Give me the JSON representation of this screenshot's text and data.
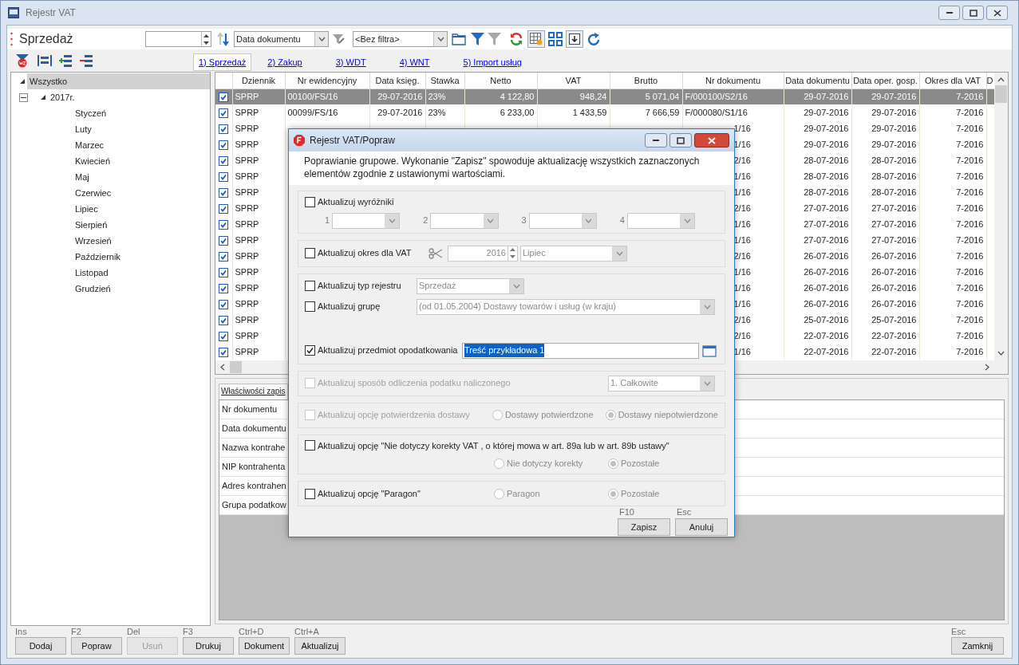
{
  "window": {
    "title": "Rejestr VAT"
  },
  "header": {
    "title": "Sprzedaż",
    "sort_field": "Data dokumentu",
    "filter": "<Bez filtra>"
  },
  "register_tabs": [
    {
      "label": "1) Sprzedaż",
      "selected": true
    },
    {
      "label": "2) Zakup",
      "selected": false
    },
    {
      "label": "3) WDT",
      "selected": false
    },
    {
      "label": "4) WNT",
      "selected": false
    },
    {
      "label": "5) Import usług",
      "selected": false
    }
  ],
  "tree": [
    {
      "label": "Wszystko",
      "selected": true,
      "expanded": true,
      "children": [
        {
          "label": "2017r.",
          "selected": false,
          "expanded": true,
          "children": [
            {
              "label": "Styczeń",
              "selected": false
            },
            {
              "label": "Luty",
              "selected": false
            },
            {
              "label": "Marzec",
              "selected": false
            },
            {
              "label": "Kwiecień",
              "selected": false
            },
            {
              "label": "Maj",
              "selected": false
            },
            {
              "label": "Czerwiec",
              "selected": false
            },
            {
              "label": "Lipiec",
              "selected": false
            },
            {
              "label": "Sierpień",
              "selected": false
            },
            {
              "label": "Wrzesień",
              "selected": false
            },
            {
              "label": "Październik",
              "selected": false
            },
            {
              "label": "Listopad",
              "selected": false
            },
            {
              "label": "Grudzień",
              "selected": false
            }
          ]
        }
      ]
    }
  ],
  "table": {
    "columns": [
      "Dziennik",
      "Nr ewidencyjny",
      "Data księg.",
      "Stawka",
      "Netto",
      "VAT",
      "Brutto",
      "Nr dokumentu",
      "Data dokumentu",
      "Data oper. gosp.",
      "Okres dla VAT",
      "D"
    ],
    "rows": [
      {
        "checked": true,
        "selected": true,
        "dziennik": "SPRP",
        "nr_ewidencyjny": "00100/FS/16",
        "data_ksieg": "29-07-2016",
        "stawka": "23%",
        "netto": "4 122,80",
        "vat": "948,24",
        "brutto": "5 071,04",
        "nr_dokumentu": "F/000100/S2/16",
        "data_dokumentu": "29-07-2016",
        "data_oper": "29-07-2016",
        "okres": "7-2016"
      },
      {
        "checked": true,
        "selected": false,
        "dziennik": "SPRP",
        "nr_ewidencyjny": "00099/FS/16",
        "data_ksieg": "29-07-2016",
        "stawka": "23%",
        "netto": "6 233,00",
        "vat": "1 433,59",
        "brutto": "7 666,59",
        "nr_dokumentu": "F/000080/S1/16",
        "data_dokumentu": "29-07-2016",
        "data_oper": "29-07-2016",
        "okres": "7-2016"
      },
      {
        "checked": true,
        "selected": false,
        "covered_by_dialog": true,
        "dziennik": "SPRP",
        "nr_dokumentu": "1/16",
        "data_dokumentu": "29-07-2016",
        "data_oper": "29-07-2016",
        "okres": "7-2016"
      },
      {
        "checked": true,
        "selected": false,
        "covered_by_dialog": true,
        "dziennik": "SPRP",
        "nr_dokumentu": "1/16",
        "data_dokumentu": "29-07-2016",
        "data_oper": "29-07-2016",
        "okres": "7-2016"
      },
      {
        "checked": true,
        "selected": false,
        "covered_by_dialog": true,
        "dziennik": "SPRP",
        "nr_dokumentu": "2/16",
        "data_dokumentu": "28-07-2016",
        "data_oper": "28-07-2016",
        "okres": "7-2016"
      },
      {
        "checked": true,
        "selected": false,
        "covered_by_dialog": true,
        "dziennik": "SPRP",
        "nr_dokumentu": "1/16",
        "data_dokumentu": "28-07-2016",
        "data_oper": "28-07-2016",
        "okres": "7-2016"
      },
      {
        "checked": true,
        "selected": false,
        "covered_by_dialog": true,
        "dziennik": "SPRP",
        "nr_dokumentu": "1/16",
        "data_dokumentu": "28-07-2016",
        "data_oper": "28-07-2016",
        "okres": "7-2016"
      },
      {
        "checked": true,
        "selected": false,
        "covered_by_dialog": true,
        "dziennik": "SPRP",
        "nr_dokumentu": "2/16",
        "data_dokumentu": "27-07-2016",
        "data_oper": "27-07-2016",
        "okres": "7-2016"
      },
      {
        "checked": true,
        "selected": false,
        "covered_by_dialog": true,
        "dziennik": "SPRP",
        "nr_dokumentu": "1/16",
        "data_dokumentu": "27-07-2016",
        "data_oper": "27-07-2016",
        "okres": "7-2016"
      },
      {
        "checked": true,
        "selected": false,
        "covered_by_dialog": true,
        "dziennik": "SPRP",
        "nr_dokumentu": "1/16",
        "data_dokumentu": "27-07-2016",
        "data_oper": "27-07-2016",
        "okres": "7-2016"
      },
      {
        "checked": true,
        "selected": false,
        "covered_by_dialog": true,
        "dziennik": "SPRP",
        "nr_dokumentu": "2/16",
        "data_dokumentu": "26-07-2016",
        "data_oper": "26-07-2016",
        "okres": "7-2016"
      },
      {
        "checked": true,
        "selected": false,
        "covered_by_dialog": true,
        "dziennik": "SPRP",
        "nr_dokumentu": "1/16",
        "data_dokumentu": "26-07-2016",
        "data_oper": "26-07-2016",
        "okres": "7-2016"
      },
      {
        "checked": true,
        "selected": false,
        "covered_by_dialog": true,
        "dziennik": "SPRP",
        "nr_dokumentu": "1/16",
        "data_dokumentu": "26-07-2016",
        "data_oper": "26-07-2016",
        "okres": "7-2016"
      },
      {
        "checked": true,
        "selected": false,
        "covered_by_dialog": true,
        "dziennik": "SPRP",
        "nr_dokumentu": "1/16",
        "data_dokumentu": "26-07-2016",
        "data_oper": "26-07-2016",
        "okres": "7-2016"
      },
      {
        "checked": true,
        "selected": false,
        "covered_by_dialog": true,
        "dziennik": "SPRP",
        "nr_dokumentu": "2/16",
        "data_dokumentu": "25-07-2016",
        "data_oper": "25-07-2016",
        "okres": "7-2016"
      },
      {
        "checked": true,
        "selected": false,
        "covered_by_dialog": true,
        "dziennik": "SPRP",
        "nr_dokumentu": "2/16",
        "data_dokumentu": "22-07-2016",
        "data_oper": "22-07-2016",
        "okres": "7-2016"
      },
      {
        "checked": true,
        "selected": false,
        "covered_by_dialog": true,
        "dziennik": "SPRP",
        "nr_dokumentu": "1/16",
        "data_dokumentu": "22-07-2016",
        "data_oper": "22-07-2016",
        "okres": "7-2016"
      }
    ]
  },
  "properties": {
    "tab": "Właściwości zapis",
    "labels": [
      "Nr dokumentu",
      "Data dokumentu",
      "Nazwa kontrahe",
      "NIP kontrahenta",
      "Adres kontrahen",
      "Grupa podatkow"
    ]
  },
  "buttons": [
    {
      "shortcut": "Ins",
      "label": "Dodaj",
      "disabled": false
    },
    {
      "shortcut": "F2",
      "label": "Popraw",
      "disabled": false
    },
    {
      "shortcut": "Del",
      "label": "Usuń",
      "disabled": true
    },
    {
      "shortcut": "F3",
      "label": "Drukuj",
      "disabled": false
    },
    {
      "shortcut": "Ctrl+D",
      "label": "Dokument",
      "disabled": false
    },
    {
      "shortcut": "Ctrl+A",
      "label": "Aktualizuj",
      "disabled": false
    }
  ],
  "close_button": {
    "shortcut": "Esc",
    "label": "Zamknij"
  },
  "dialog": {
    "title": "Rejestr VAT/Popraw",
    "description": "Poprawianie grupowe. Wykonanie \"Zapisz\" spowoduje aktualizację wszystkich zaznaczonych elementów zgodnie z ustawionymi wartościami.",
    "groups": [
      [
        {
          "kind": "markers",
          "label": "Aktualizuj wyróżniki",
          "checked": false,
          "disabled": false,
          "markers": [
            "1",
            "2",
            "3",
            "4"
          ]
        }
      ],
      [
        {
          "kind": "period",
          "label": "Aktualizuj okres dla VAT",
          "checked": false,
          "disabled": false,
          "year": "2016",
          "month": "Lipiec"
        }
      ],
      [
        {
          "kind": "combo",
          "label": "Aktualizuj typ rejestru",
          "checked": false,
          "disabled": false,
          "value": "Sprzedaż"
        },
        {
          "kind": "widecombo",
          "label": "Aktualizuj grupę",
          "checked": false,
          "disabled": false,
          "value": "(od 01.05.2004) Dostawy towarów i usług (w kraju)"
        },
        {
          "kind": "text",
          "label": "Aktualizuj przedmiot opodatkowania",
          "checked": true,
          "disabled": false,
          "value": "Treść przykładowa 1"
        }
      ],
      [
        {
          "kind": "rightcombo",
          "label": "Aktualizuj sposób odliczenia podatku naliczonego",
          "checked": false,
          "disabled": true,
          "value": "1. Całkowite"
        }
      ],
      [
        {
          "kind": "radios",
          "label": "Aktualizuj opcję potwierdzenia dostawy",
          "checked": false,
          "disabled": true,
          "options": [
            {
              "label": "Dostawy potwierdzone",
              "selected": false
            },
            {
              "label": "Dostawy niepotwierdzone",
              "selected": true
            }
          ]
        }
      ],
      [
        {
          "kind": "radiosbelow",
          "label": "Aktualizuj opcję \"Nie dotyczy korekty VAT , o której mowa w art. 89a lub w art. 89b ustawy\"",
          "checked": false,
          "disabled": false,
          "options": [
            {
              "label": "Nie dotyczy korekty",
              "selected": false
            },
            {
              "label": "Pozostałe",
              "selected": true
            }
          ]
        }
      ],
      [
        {
          "kind": "radios",
          "label": "Aktualizuj opcję \"Paragon\"",
          "checked": false,
          "disabled": false,
          "options": [
            {
              "label": "Paragon",
              "selected": false
            },
            {
              "label": "Pozostałe",
              "selected": true
            }
          ]
        }
      ]
    ],
    "buttons": [
      {
        "shortcut": "F10",
        "label": "Zapisz"
      },
      {
        "shortcut": "Esc",
        "label": "Anuluj"
      }
    ]
  }
}
